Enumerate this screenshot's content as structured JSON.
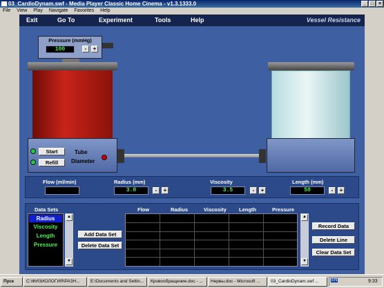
{
  "window": {
    "title": "03_CardioDynam.swf - Media Player Classic Home Cinema - v1.3.1333.0"
  },
  "player_menu": [
    "File",
    "View",
    "Play",
    "Navigate",
    "Favorites",
    "Help"
  ],
  "app_menu": {
    "exit": "Exit",
    "goto": "Go To",
    "experiment": "Experiment",
    "tools": "Tools",
    "help": "Help",
    "title": "Vessel Resistance"
  },
  "pressure": {
    "label": "Pressure (mmHg)",
    "value": "100"
  },
  "controls": {
    "start": "Start",
    "refill": "Refill",
    "tube": "Tube",
    "diameter": "Diameter"
  },
  "params": {
    "flow_label": "Flow (ml/min)",
    "flow_value": "",
    "radius_label": "Radius (mm)",
    "radius_value": "3.0",
    "viscosity_label": "Viscosity",
    "viscosity_value": "3.5",
    "length_label": "Length (mm)",
    "length_value": "50"
  },
  "datasets": {
    "title": "Data Sets",
    "items": [
      "Radius",
      "Viscosity",
      "Length",
      "Pressure"
    ],
    "add": "Add Data Set",
    "delete": "Delete Data Set"
  },
  "table": {
    "columns": [
      "Flow",
      "Radius",
      "Viscosity",
      "Length",
      "Pressure"
    ]
  },
  "actions": {
    "record": "Record Data",
    "delete_line": "Delete Line",
    "clear": "Clear Data Set"
  },
  "taskbar": {
    "start": "Пуск",
    "tasks": [
      "C:\\ФИЗИОЛОГИЯ\\РАЗН...",
      "E:\\Documents and Settin...",
      "Кровообращение.doc - ...",
      "Нервы.doc - Microsoft ...",
      "03_CardioDynam.swf ..."
    ],
    "lang": "EN",
    "time": "9:33"
  },
  "colors": {
    "fluid": "#b01a10",
    "panel": "#3e5fa1",
    "lcd_text": "#4cf04c"
  }
}
